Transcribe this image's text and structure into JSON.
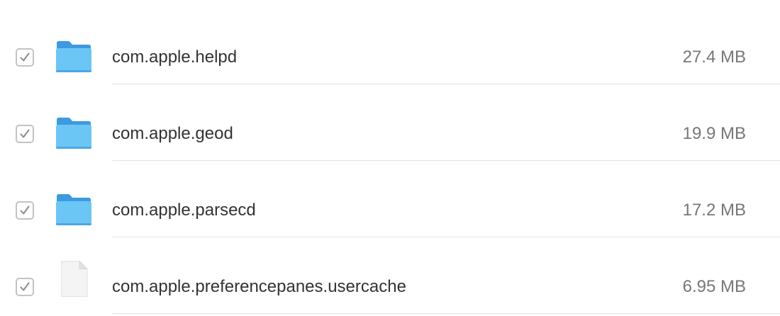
{
  "files": [
    {
      "name": "com.apple.helpd",
      "size": "27.4 MB",
      "type": "folder",
      "checked": true
    },
    {
      "name": "com.apple.geod",
      "size": "19.9 MB",
      "type": "folder",
      "checked": true
    },
    {
      "name": "com.apple.parsecd",
      "size": "17.2 MB",
      "type": "folder",
      "checked": true
    },
    {
      "name": "com.apple.preferencepanes.usercache",
      "size": "6.95 MB",
      "type": "document",
      "checked": true
    }
  ],
  "icons": {
    "folder": "folder-icon",
    "document": "document-icon",
    "check": "checkmark-icon"
  },
  "colors": {
    "folder_front": "#6cc6f5",
    "folder_back": "#3b9ae0",
    "checkbox_border": "#c3c3c3",
    "name_text": "#333333",
    "size_text": "#777777",
    "divider": "#e3e3e3"
  }
}
